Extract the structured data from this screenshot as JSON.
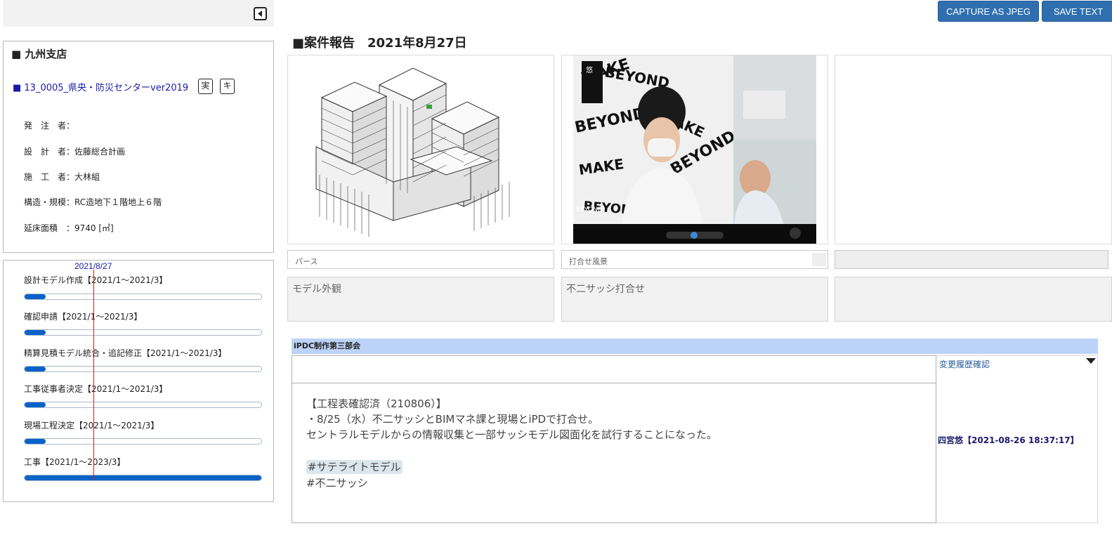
{
  "actions": {
    "capture_jpeg": "CAPTURE AS JPEG",
    "save_text": "SAVE TEXT"
  },
  "info": {
    "branch": "■ 九州支店",
    "project": "■ 13_0005_県央・防災センターver2019",
    "btn_mi": "実",
    "btn_ki": "キ",
    "rows": [
      "発　注　者：",
      "設　計　者：佐藤総合計画",
      "施　工　者：大林組",
      "構造・規模：RC造地下１階地上６階",
      "延床面積　：9740 [㎡]"
    ]
  },
  "schedule": {
    "today": "2021/8/27",
    "today_fraction": 0.29,
    "tasks": [
      {
        "label": "設計モデル作成【2021/1～2021/3】",
        "progress": 0.09
      },
      {
        "label": "確認申請【2021/1～2021/3】",
        "progress": 0.09
      },
      {
        "label": "精算見積モデル統合・追記修正【2021/1～2021/3】",
        "progress": 0.09
      },
      {
        "label": "工事従事者決定【2021/1～2021/3】",
        "progress": 0.09
      },
      {
        "label": "現場工程決定【2021/1～2021/3】",
        "progress": 0.09
      },
      {
        "label": "工事【2021/1～2023/3】",
        "progress": 1.0
      }
    ]
  },
  "report": {
    "title": "■案件報告　2021年8月27日",
    "images": [
      {
        "caption": "パース",
        "description": "モデル外観"
      },
      {
        "caption": "打合せ風景",
        "description": "不二サッシ打合せ"
      },
      {
        "caption": "",
        "description": ""
      }
    ],
    "video_overlay": "悠"
  },
  "comment": {
    "group": "iPDC制作第三部会",
    "lines": [
      "【工程表確認済（210806）】",
      "・8/25（水）不二サッシとBIMマネ課と現場とiPDで打合せ。",
      "セントラルモデルからの情報収集と一部サッシモデル図面化を試行することになった。",
      "",
      "#サテライトモデル",
      "#不二サッシ"
    ],
    "history_link": "変更履歴確認",
    "author": "四宮悠【2021-08-26 18:37:17】"
  }
}
